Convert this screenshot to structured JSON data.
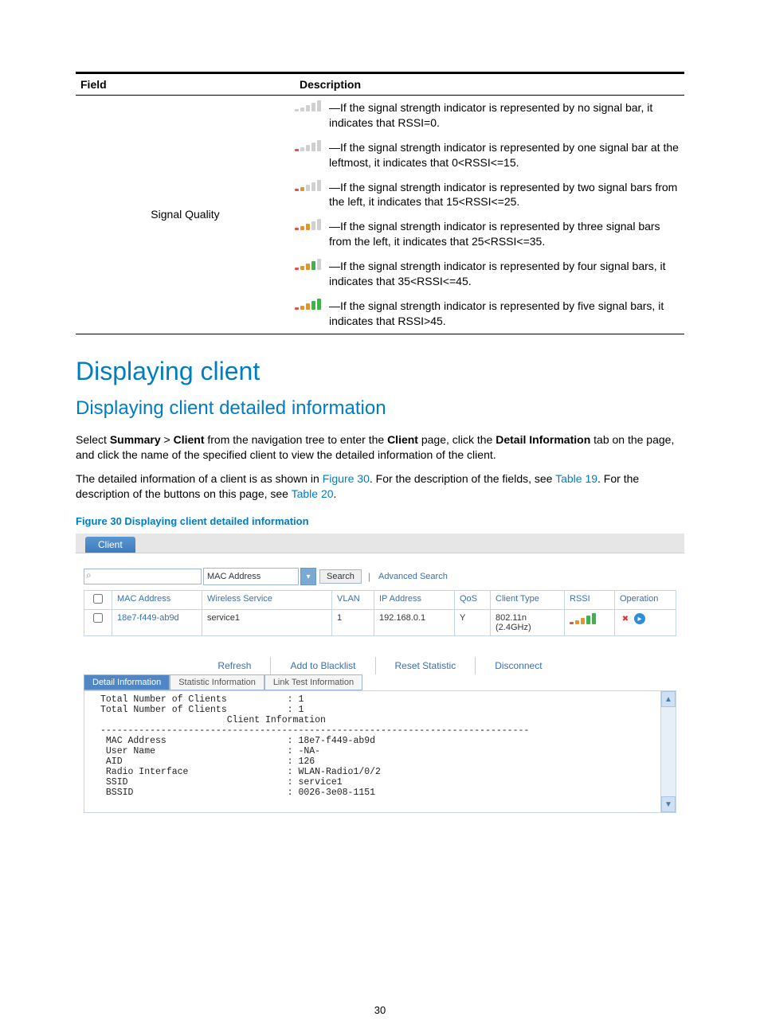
{
  "table": {
    "header": {
      "field": "Field",
      "description": "Description"
    },
    "row": {
      "label": "Signal Quality",
      "items": [
        {
          "text": "—If the signal strength indicator is represented by no signal bar, it indicates that RSSI=0."
        },
        {
          "text": "—If the signal strength indicator is represented by one signal bar at the leftmost, it indicates that 0<RSSI<=15."
        },
        {
          "text": "—If the signal strength indicator is represented by two signal bars from the left, it indicates that 15<RSSI<=25."
        },
        {
          "text": "—If the signal strength indicator is represented by three signal bars from the left, it indicates that 25<RSSI<=35."
        },
        {
          "text": "—If the signal strength indicator is represented by four signal bars, it indicates that 35<RSSI<=45."
        },
        {
          "text": "—If the signal strength indicator is represented by five signal bars, it indicates that RSSI>45."
        }
      ]
    }
  },
  "h1": "Displaying client",
  "h2": "Displaying client detailed information",
  "para1_a": "Select ",
  "para1_b": "Summary",
  "para1_c": " > ",
  "para1_d": "Client",
  "para1_e": " from the navigation tree to enter the ",
  "para1_f": "Client",
  "para1_g": " page, click the ",
  "para1_h": "Detail Information",
  "para1_i": " tab on the page, and click the name of the specified client to view the detailed information of the client.",
  "para2_a": "The detailed information of a client is as shown in ",
  "para2_b": "Figure 30",
  "para2_c": ". For the description of the fields, see ",
  "para2_d": "Table 19",
  "para2_e": ". For the description of the buttons on this page, see ",
  "para2_f": "Table 20",
  "para2_g": ".",
  "figcap": "Figure 30 Displaying client detailed information",
  "ui": {
    "tab": "Client",
    "search_select": "MAC Address",
    "search_btn": "Search",
    "adv_search": "Advanced Search",
    "headers": {
      "mac": "MAC Address",
      "ws": "Wireless Service",
      "vl": "VLAN",
      "ip": "IP Address",
      "qos": "QoS",
      "ct": "Client Type",
      "rs": "RSSI",
      "op": "Operation"
    },
    "row": {
      "mac": "18e7-f449-ab9d",
      "ws": "service1",
      "vl": "1",
      "ip": "192.168.0.1",
      "qos": "Y",
      "ct": "802.11n (2.4GHz)"
    },
    "buttons": {
      "refresh": "Refresh",
      "blacklist": "Add to Blacklist",
      "reset": "Reset Statistic",
      "disconnect": "Disconnect"
    },
    "tabs2": {
      "detail": "Detail Information",
      "stat": "Statistic Information",
      "link": "Link Test Information"
    },
    "detail": "Total Number of Clients           : 1\nTotal Number of Clients           : 1\n                       Client Information\n------------------------------------------------------------------------------\n MAC Address                      : 18e7-f449-ab9d\n User Name                        : -NA-\n AID                              : 126\n Radio Interface                  : WLAN-Radio1/0/2\n SSID                             : service1\n BSSID                            : 0026-3e08-1151"
  },
  "pagenum": "30"
}
